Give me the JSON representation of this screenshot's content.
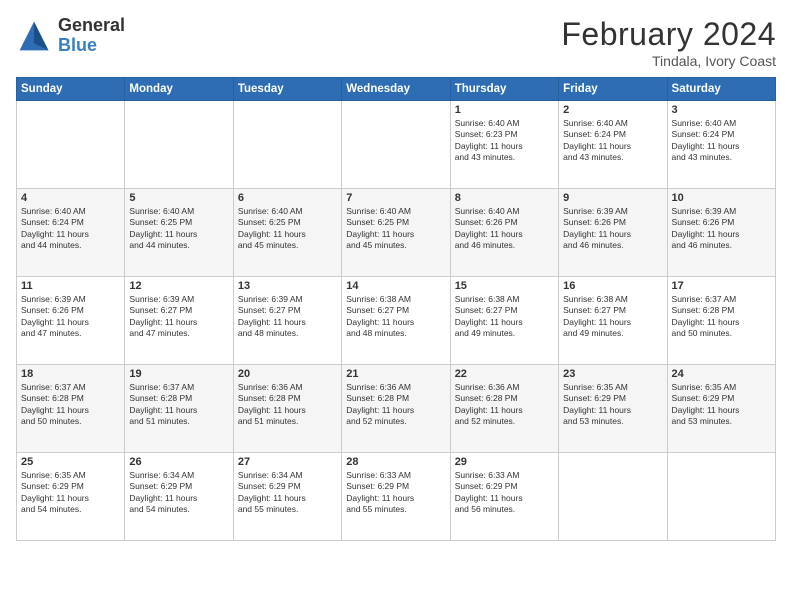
{
  "header": {
    "logo_general": "General",
    "logo_blue": "Blue",
    "month_title": "February 2024",
    "subtitle": "Tindala, Ivory Coast"
  },
  "days_of_week": [
    "Sunday",
    "Monday",
    "Tuesday",
    "Wednesday",
    "Thursday",
    "Friday",
    "Saturday"
  ],
  "weeks": [
    [
      {
        "day": "",
        "info": ""
      },
      {
        "day": "",
        "info": ""
      },
      {
        "day": "",
        "info": ""
      },
      {
        "day": "",
        "info": ""
      },
      {
        "day": "1",
        "info": "Sunrise: 6:40 AM\nSunset: 6:23 PM\nDaylight: 11 hours\nand 43 minutes."
      },
      {
        "day": "2",
        "info": "Sunrise: 6:40 AM\nSunset: 6:24 PM\nDaylight: 11 hours\nand 43 minutes."
      },
      {
        "day": "3",
        "info": "Sunrise: 6:40 AM\nSunset: 6:24 PM\nDaylight: 11 hours\nand 43 minutes."
      }
    ],
    [
      {
        "day": "4",
        "info": "Sunrise: 6:40 AM\nSunset: 6:24 PM\nDaylight: 11 hours\nand 44 minutes."
      },
      {
        "day": "5",
        "info": "Sunrise: 6:40 AM\nSunset: 6:25 PM\nDaylight: 11 hours\nand 44 minutes."
      },
      {
        "day": "6",
        "info": "Sunrise: 6:40 AM\nSunset: 6:25 PM\nDaylight: 11 hours\nand 45 minutes."
      },
      {
        "day": "7",
        "info": "Sunrise: 6:40 AM\nSunset: 6:25 PM\nDaylight: 11 hours\nand 45 minutes."
      },
      {
        "day": "8",
        "info": "Sunrise: 6:40 AM\nSunset: 6:26 PM\nDaylight: 11 hours\nand 46 minutes."
      },
      {
        "day": "9",
        "info": "Sunrise: 6:39 AM\nSunset: 6:26 PM\nDaylight: 11 hours\nand 46 minutes."
      },
      {
        "day": "10",
        "info": "Sunrise: 6:39 AM\nSunset: 6:26 PM\nDaylight: 11 hours\nand 46 minutes."
      }
    ],
    [
      {
        "day": "11",
        "info": "Sunrise: 6:39 AM\nSunset: 6:26 PM\nDaylight: 11 hours\nand 47 minutes."
      },
      {
        "day": "12",
        "info": "Sunrise: 6:39 AM\nSunset: 6:27 PM\nDaylight: 11 hours\nand 47 minutes."
      },
      {
        "day": "13",
        "info": "Sunrise: 6:39 AM\nSunset: 6:27 PM\nDaylight: 11 hours\nand 48 minutes."
      },
      {
        "day": "14",
        "info": "Sunrise: 6:38 AM\nSunset: 6:27 PM\nDaylight: 11 hours\nand 48 minutes."
      },
      {
        "day": "15",
        "info": "Sunrise: 6:38 AM\nSunset: 6:27 PM\nDaylight: 11 hours\nand 49 minutes."
      },
      {
        "day": "16",
        "info": "Sunrise: 6:38 AM\nSunset: 6:27 PM\nDaylight: 11 hours\nand 49 minutes."
      },
      {
        "day": "17",
        "info": "Sunrise: 6:37 AM\nSunset: 6:28 PM\nDaylight: 11 hours\nand 50 minutes."
      }
    ],
    [
      {
        "day": "18",
        "info": "Sunrise: 6:37 AM\nSunset: 6:28 PM\nDaylight: 11 hours\nand 50 minutes."
      },
      {
        "day": "19",
        "info": "Sunrise: 6:37 AM\nSunset: 6:28 PM\nDaylight: 11 hours\nand 51 minutes."
      },
      {
        "day": "20",
        "info": "Sunrise: 6:36 AM\nSunset: 6:28 PM\nDaylight: 11 hours\nand 51 minutes."
      },
      {
        "day": "21",
        "info": "Sunrise: 6:36 AM\nSunset: 6:28 PM\nDaylight: 11 hours\nand 52 minutes."
      },
      {
        "day": "22",
        "info": "Sunrise: 6:36 AM\nSunset: 6:28 PM\nDaylight: 11 hours\nand 52 minutes."
      },
      {
        "day": "23",
        "info": "Sunrise: 6:35 AM\nSunset: 6:29 PM\nDaylight: 11 hours\nand 53 minutes."
      },
      {
        "day": "24",
        "info": "Sunrise: 6:35 AM\nSunset: 6:29 PM\nDaylight: 11 hours\nand 53 minutes."
      }
    ],
    [
      {
        "day": "25",
        "info": "Sunrise: 6:35 AM\nSunset: 6:29 PM\nDaylight: 11 hours\nand 54 minutes."
      },
      {
        "day": "26",
        "info": "Sunrise: 6:34 AM\nSunset: 6:29 PM\nDaylight: 11 hours\nand 54 minutes."
      },
      {
        "day": "27",
        "info": "Sunrise: 6:34 AM\nSunset: 6:29 PM\nDaylight: 11 hours\nand 55 minutes."
      },
      {
        "day": "28",
        "info": "Sunrise: 6:33 AM\nSunset: 6:29 PM\nDaylight: 11 hours\nand 55 minutes."
      },
      {
        "day": "29",
        "info": "Sunrise: 6:33 AM\nSunset: 6:29 PM\nDaylight: 11 hours\nand 56 minutes."
      },
      {
        "day": "",
        "info": ""
      },
      {
        "day": "",
        "info": ""
      }
    ]
  ],
  "colors": {
    "header_bg": "#2e6db4",
    "accent": "#3a7fc1"
  }
}
